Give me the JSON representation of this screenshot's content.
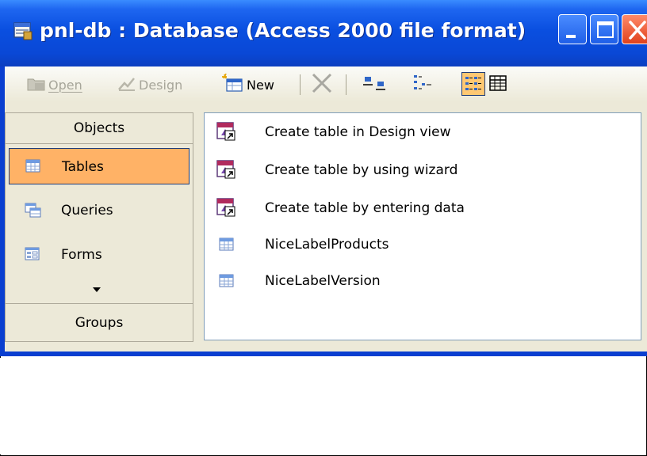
{
  "window": {
    "title": "pnl-db : Database (Access 2000 file format)"
  },
  "toolbar": {
    "open_label": "Open",
    "design_label": "Design",
    "new_label": "New",
    "view_buttons": [
      "large-icons",
      "small-icons",
      "list",
      "details"
    ],
    "selected_view": "list"
  },
  "objects_bar": {
    "header": "Objects",
    "items": [
      {
        "label": "Tables",
        "icon": "table-icon",
        "selected": true
      },
      {
        "label": "Queries",
        "icon": "query-icon",
        "selected": false
      },
      {
        "label": "Forms",
        "icon": "form-icon",
        "selected": false
      }
    ],
    "groups_label": "Groups"
  },
  "list": {
    "items": [
      {
        "label": "Create table in Design view",
        "icon": "shortcut-design-icon"
      },
      {
        "label": "Create table by using wizard",
        "icon": "shortcut-wizard-icon"
      },
      {
        "label": "Create table by entering data",
        "icon": "shortcut-datasheet-icon"
      },
      {
        "label": "NiceLabelProducts",
        "icon": "table-icon"
      },
      {
        "label": "NiceLabelVersion",
        "icon": "table-icon"
      }
    ]
  },
  "colors": {
    "title_bar": "#0a4fe0",
    "selection": "#ffb266",
    "client_background": "#ece9d8"
  }
}
